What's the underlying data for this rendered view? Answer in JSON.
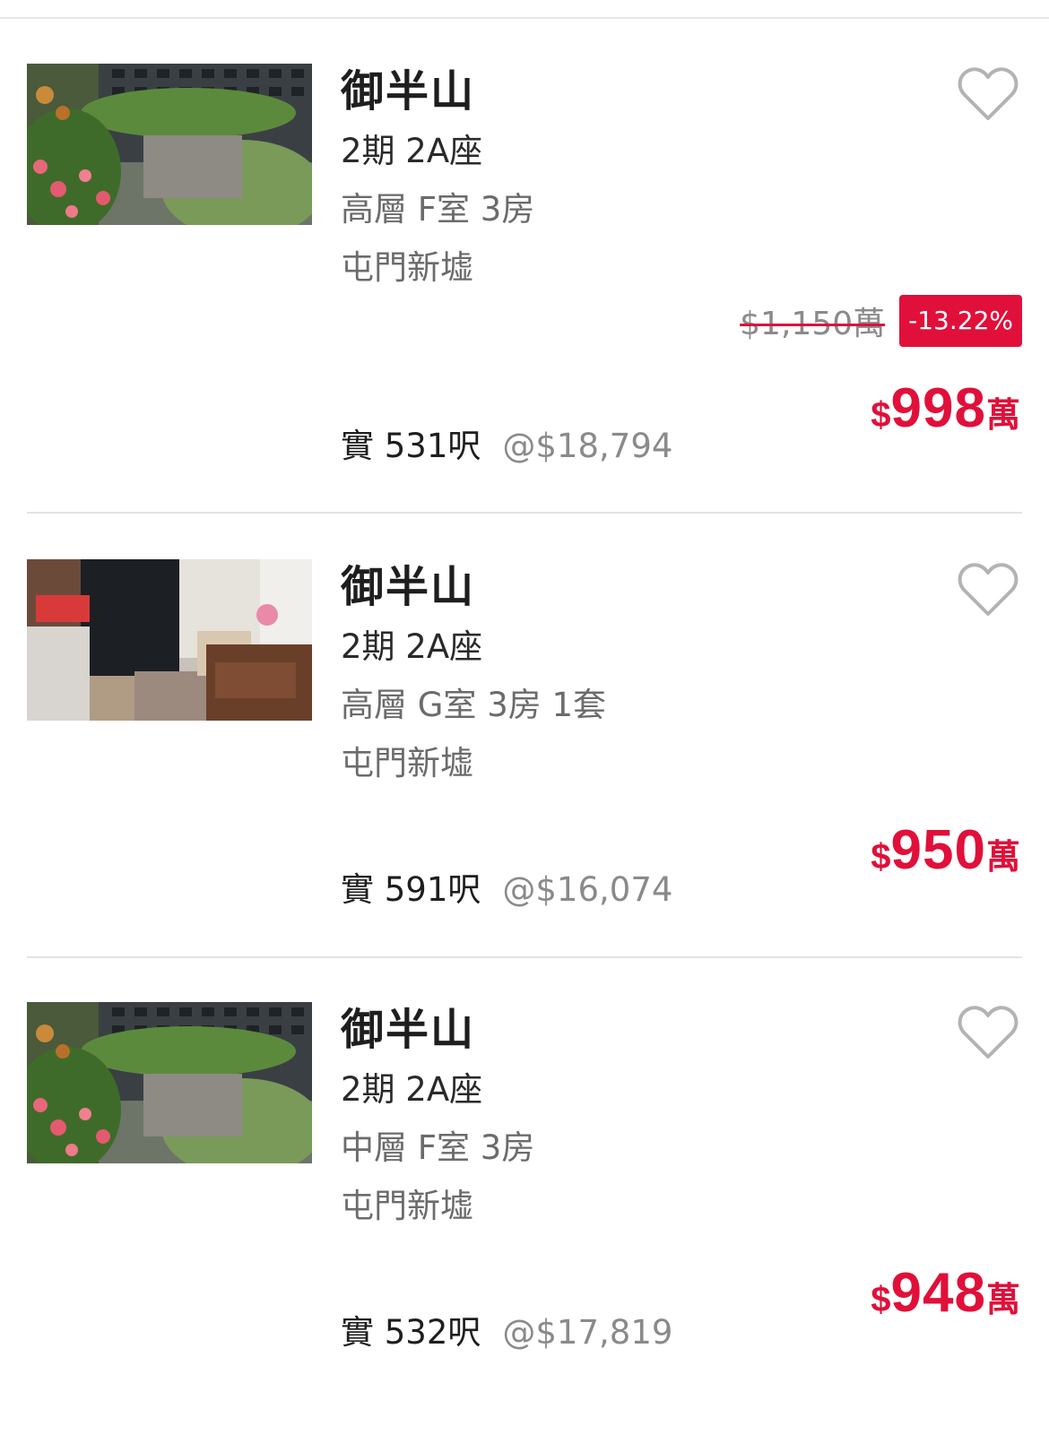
{
  "listings": [
    {
      "title": "御半山",
      "phase": "2期 2A座",
      "unit": "高層 F室 3房",
      "district": "屯門新墟",
      "area": "實 531呎",
      "price_per_sqft": "@$18,794",
      "original_price": "$1,150萬",
      "discount": "-13.22%",
      "price_currency": "$",
      "price_value": "998",
      "price_unit": "萬",
      "favorite": false,
      "photo": "building-exterior-photo"
    },
    {
      "title": "御半山",
      "phase": "2期 2A座",
      "unit": "高層 G室 3房 1套",
      "district": "屯門新墟",
      "area": "實 591呎",
      "price_per_sqft": "@$16,074",
      "price_currency": "$",
      "price_value": "950",
      "price_unit": "萬",
      "favorite": false,
      "photo": "living-room-photo"
    },
    {
      "title": "御半山",
      "phase": "2期 2A座",
      "unit": "中層 F室 3房",
      "district": "屯門新墟",
      "area": "實 532呎",
      "price_per_sqft": "@$17,819",
      "price_currency": "$",
      "price_value": "948",
      "price_unit": "萬",
      "favorite": false,
      "photo": "building-exterior-photo"
    }
  ],
  "colors": {
    "price": "#e0103a",
    "discount_badge": "#e0103a",
    "secondary_text": "#6b6b6b",
    "divider": "#e3e3e3"
  },
  "icons": {
    "favorite": "heart-outline-icon"
  }
}
